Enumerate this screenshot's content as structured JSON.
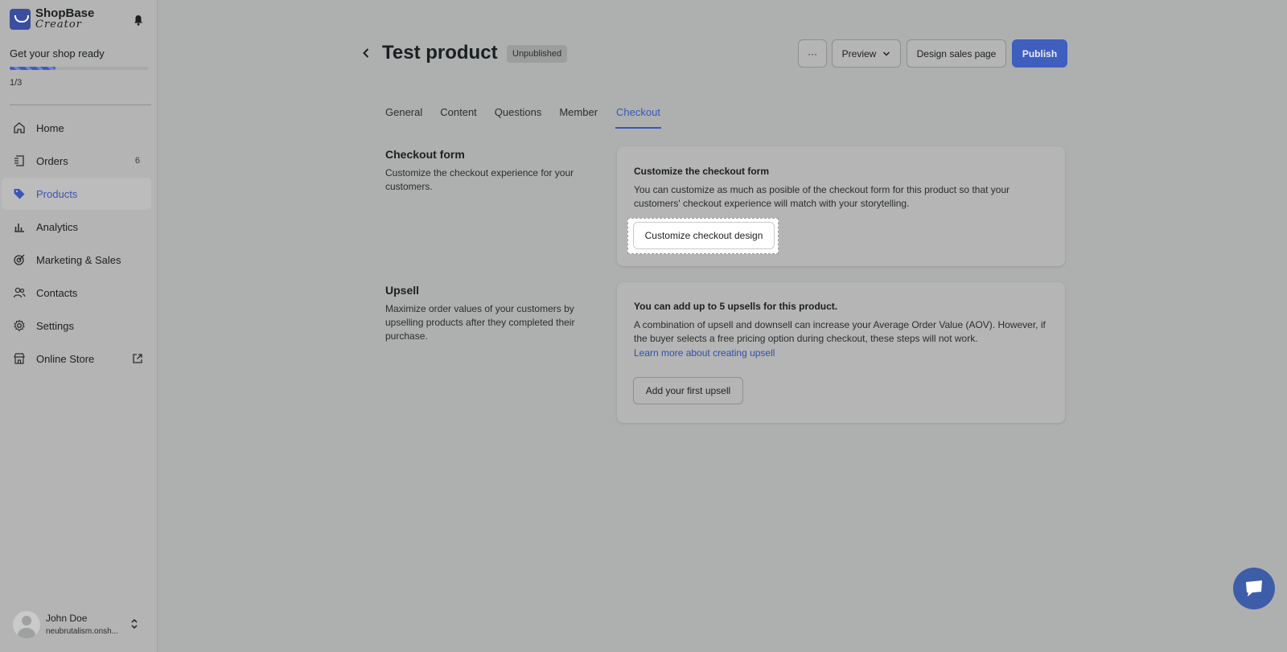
{
  "app": {
    "logo_line1": "ShopBase",
    "logo_line2": "Creator"
  },
  "setup": {
    "title": "Get your shop ready",
    "progress_fraction": 0.333,
    "count": "1/3"
  },
  "sidebar": {
    "items": [
      {
        "label": "Home",
        "icon": "home-icon"
      },
      {
        "label": "Orders",
        "icon": "orders-icon",
        "badge": "6"
      },
      {
        "label": "Products",
        "icon": "tag-icon",
        "active": true
      },
      {
        "label": "Analytics",
        "icon": "bar-chart-icon"
      },
      {
        "label": "Marketing & Sales",
        "icon": "target-icon"
      },
      {
        "label": "Contacts",
        "icon": "contacts-icon"
      },
      {
        "label": "Settings",
        "icon": "gear-icon"
      },
      {
        "label": "Online Store",
        "icon": "store-icon"
      }
    ]
  },
  "user": {
    "name": "John Doe",
    "store": "neubrutalism.onsh..."
  },
  "header": {
    "title": "Test product",
    "status": "Unpublished",
    "more_label": "···",
    "preview_label": "Preview",
    "design_label": "Design sales page",
    "publish_label": "Publish"
  },
  "tabs": [
    "General",
    "Content",
    "Questions",
    "Member",
    "Checkout"
  ],
  "active_tab": "Checkout",
  "checkout": {
    "title": "Checkout form",
    "desc": "Customize the checkout experience for your customers.",
    "card_title": "Customize the checkout form",
    "card_text": "You can customize as much as posible of the checkout form for this product so that your customers' checkout experience will match with your storytelling.",
    "button": "Customize checkout design"
  },
  "upsell": {
    "title": "Upsell",
    "desc": "Maximize order values of your customers by upselling products after they completed their purchase.",
    "card_title": "You can add up to 5 upsells for this product.",
    "card_text": "A combination of upsell and downsell can increase your Average Order Value (AOV). However, if the buyer selects a free pricing option during checkout, these steps will not work.",
    "link": "Learn more about creating upsell",
    "button": "Add your first upsell"
  },
  "colors": {
    "accent": "#3f5fbf",
    "overlay_bg": "#aeb0af"
  }
}
